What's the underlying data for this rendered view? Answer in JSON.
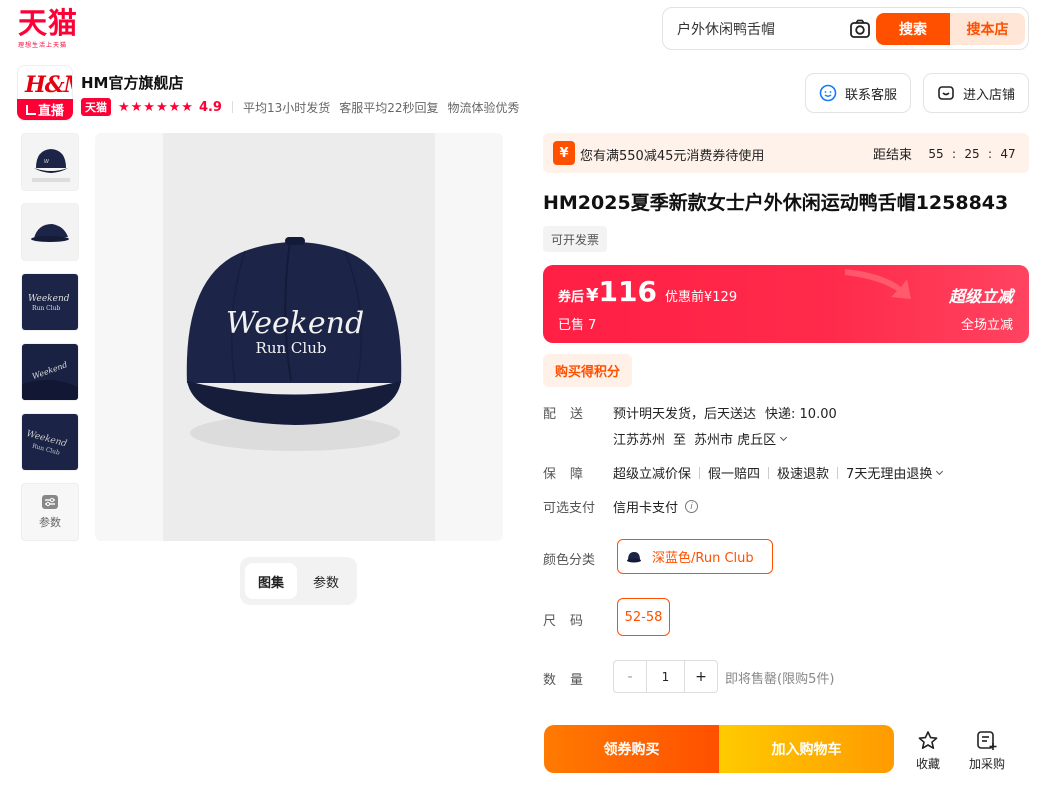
{
  "header": {
    "logo": "天猫",
    "logo_tagline": "理想生活上天猫",
    "search_value": "户外休闲鸭舌帽",
    "search_button": "搜索",
    "shop_search_button": "搜本店"
  },
  "shop": {
    "logo_text": "H&M",
    "live_label": "直播",
    "name": "HM官方旗舰店",
    "tag": "天猫",
    "stars": "★★★★★★",
    "rating": "4.9",
    "metrics": [
      "平均13小时发货",
      "客服平均22秒回复",
      "物流体验优秀"
    ],
    "contact_button": "联系客服",
    "enter_store_button": "进入店铺"
  },
  "gallery": {
    "params_label": "参数",
    "tabs": [
      "图集",
      "参数"
    ],
    "cap_text_line1": "Weekend",
    "cap_text_line2": "Run Club"
  },
  "coupon": {
    "icon": "¥",
    "text": "您有满550减45元消费券待使用",
    "countdown_label": "距结束",
    "hh": "55",
    "mm": "25",
    "ss": "47"
  },
  "product": {
    "title": "HM2025夏季新款女士户外休闲运动鸭舌帽1258843",
    "invoice": "可开发票"
  },
  "price": {
    "prefix": "券后",
    "currency": "¥",
    "value": "116",
    "original": "优惠前¥129",
    "sold": "已售 7",
    "promo_title": "超级立减",
    "promo_sub": "全场立减"
  },
  "points_tag": "购买得积分",
  "delivery": {
    "label": "配送",
    "line1": "预计明天发货，后天送达",
    "shipping": "快递: 10.00",
    "from": "江苏苏州",
    "to_word": "至",
    "to": "苏州市 虎丘区"
  },
  "guarantee": {
    "label": "保障",
    "items": [
      "超级立减价保",
      "假一赔四",
      "极速退款",
      "7天无理由退换"
    ]
  },
  "payment": {
    "label": "可选支付",
    "value": "信用卡支付",
    "info_icon": "i"
  },
  "sku": {
    "color_label": "颜色分类",
    "color_value": "深蓝色/Run Club",
    "size_label": "尺码",
    "size_value": "52-58"
  },
  "quantity": {
    "label": "数量",
    "minus": "-",
    "value": "1",
    "plus": "+",
    "note": "即将售罄(限购5件)"
  },
  "actions": {
    "buy": "领券购买",
    "cart": "加入购物车",
    "favorite": "收藏",
    "purchase_list": "加采购"
  },
  "colors": {
    "brand_red": "#ff0036",
    "accent_orange": "#ff5000",
    "cap_navy": "#1c2547"
  }
}
